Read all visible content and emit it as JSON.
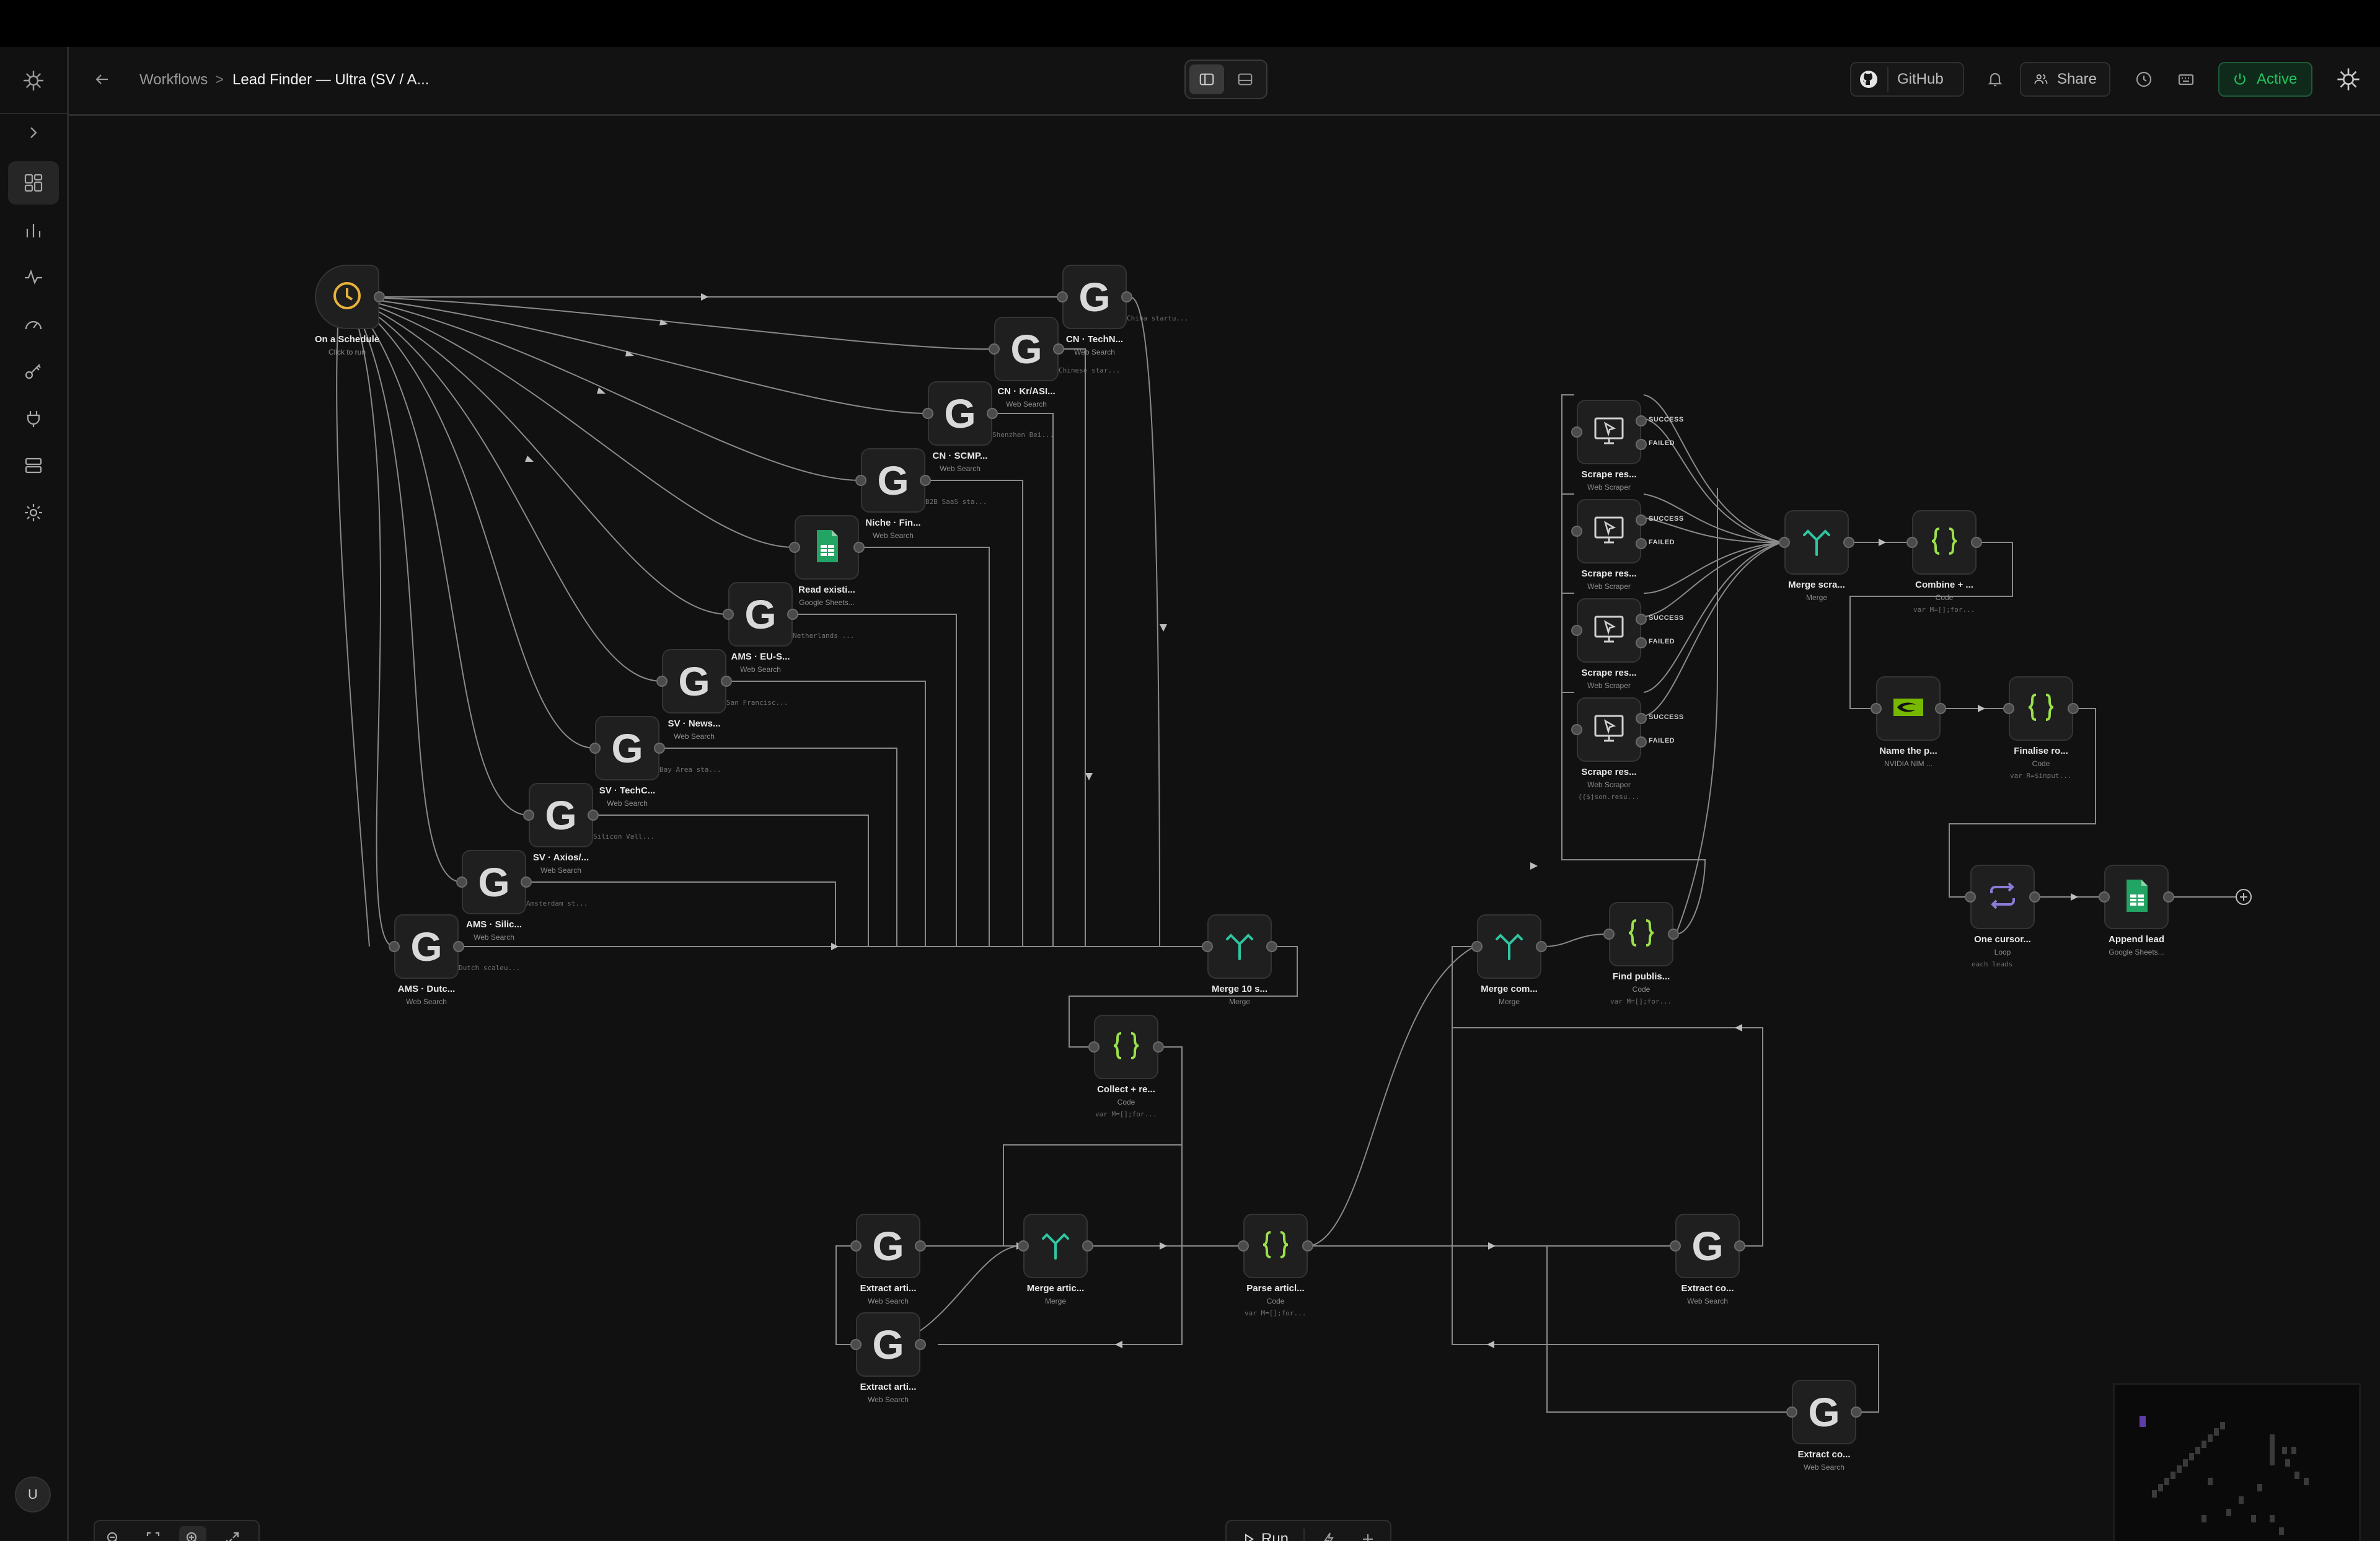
{
  "header": {
    "breadcrumb_root": "Workflows",
    "breadcrumb_sep": ">",
    "workflow_title": "Lead Finder — Ultra (SV / A...",
    "github_label": "GitHub",
    "share_label": "Share",
    "active_label": "Active",
    "active_color": "#22c55e"
  },
  "sidebar": {
    "items": [
      {
        "icon": "workflows-grid-icon"
      },
      {
        "icon": "bar-chart-icon"
      },
      {
        "icon": "activity-icon"
      },
      {
        "icon": "gauge-icon"
      },
      {
        "icon": "key-icon"
      },
      {
        "icon": "plug-icon"
      },
      {
        "icon": "server-icon"
      },
      {
        "icon": "settings-icon"
      }
    ],
    "user_initial": "U"
  },
  "bottom": {
    "run_label": "Run"
  },
  "nodes": [
    {
      "id": "schedule",
      "label": "On a Schedule",
      "sub": "Click to run",
      "icon": "clock-icon"
    },
    {
      "id": "cn-technode",
      "label": "CN · TechN...",
      "sub": "Web Search",
      "code": "China startu...",
      "icon": "google-g-icon"
    },
    {
      "id": "cn-kr",
      "label": "CN · Kr/ASI...",
      "sub": "Web Search",
      "code": "Chinese star...",
      "icon": "google-g-icon"
    },
    {
      "id": "cn-scmp",
      "label": "CN · SCMP...",
      "sub": "Web Search",
      "code": "Shenzhen Bei...",
      "icon": "google-g-icon"
    },
    {
      "id": "niche-fin",
      "label": "Niche · Fin...",
      "sub": "Web Search",
      "code": "B2B SaaS sta...",
      "icon": "google-g-icon"
    },
    {
      "id": "read-existing",
      "label": "Read existi...",
      "sub": "Google Sheets...",
      "icon": "google-sheets-icon"
    },
    {
      "id": "ams-eu",
      "label": "AMS · EU-S...",
      "sub": "Web Search",
      "code": "Netherlands ...",
      "icon": "google-g-icon"
    },
    {
      "id": "sv-news",
      "label": "SV · News...",
      "sub": "Web Search",
      "code": "San Francisc...",
      "icon": "google-g-icon"
    },
    {
      "id": "sv-techc",
      "label": "SV · TechC...",
      "sub": "Web Search",
      "code": "Bay Area sta...",
      "icon": "google-g-icon"
    },
    {
      "id": "sv-axios",
      "label": "SV · Axios/...",
      "sub": "Web Search",
      "code": "Silicon Vall...",
      "icon": "google-g-icon"
    },
    {
      "id": "ams-silic",
      "label": "AMS · Silic...",
      "sub": "Web Search",
      "code": "Amsterdam st...",
      "icon": "google-g-icon"
    },
    {
      "id": "ams-dutch",
      "label": "AMS · Dutc...",
      "sub": "Web Search",
      "code": "Dutch scaleu...",
      "icon": "google-g-icon"
    },
    {
      "id": "merge10",
      "label": "Merge 10 s...",
      "sub": "Merge",
      "icon": "merge-icon"
    },
    {
      "id": "collect",
      "label": "Collect + re...",
      "sub": "Code",
      "code": "var M=[];for...",
      "icon": "code-braces-icon"
    },
    {
      "id": "extract-art1",
      "label": "Extract arti...",
      "sub": "Web Search",
      "icon": "google-g-icon"
    },
    {
      "id": "extract-art2",
      "label": "Extract arti...",
      "sub": "Web Search",
      "icon": "google-g-icon"
    },
    {
      "id": "merge-artic",
      "label": "Merge artic...",
      "sub": "Merge",
      "icon": "merge-icon"
    },
    {
      "id": "parse-artic",
      "label": "Parse articl...",
      "sub": "Code",
      "code": "var M=[];for...",
      "icon": "code-braces-icon"
    },
    {
      "id": "extract-co1",
      "label": "Extract co...",
      "sub": "Web Search",
      "icon": "google-g-icon"
    },
    {
      "id": "extract-co2",
      "label": "Extract co...",
      "sub": "Web Search",
      "icon": "google-g-icon"
    },
    {
      "id": "merge-com",
      "label": "Merge com...",
      "sub": "Merge",
      "icon": "merge-icon"
    },
    {
      "id": "find-publis",
      "label": "Find publis...",
      "sub": "Code",
      "code": "var M=[];for...",
      "icon": "code-braces-icon"
    },
    {
      "id": "scrape1",
      "label": "Scrape res...",
      "sub": "Web Scraper",
      "icon": "monitor-cursor-icon"
    },
    {
      "id": "scrape2",
      "label": "Scrape res...",
      "sub": "Web Scraper",
      "icon": "monitor-cursor-icon"
    },
    {
      "id": "scrape3",
      "label": "Scrape res...",
      "sub": "Web Scraper",
      "icon": "monitor-cursor-icon"
    },
    {
      "id": "scrape4",
      "label": "Scrape res...",
      "sub": "Web Scraper",
      "code": "{{$json.resu...",
      "icon": "monitor-cursor-icon"
    },
    {
      "id": "merge-scra",
      "label": "Merge scra...",
      "sub": "Merge",
      "icon": "merge-icon"
    },
    {
      "id": "combine",
      "label": "Combine + ...",
      "sub": "Code",
      "code": "var M=[];for...",
      "icon": "code-braces-icon"
    },
    {
      "id": "name-the",
      "label": "Name the p...",
      "sub": "NVIDIA NIM ...",
      "icon": "nvidia-icon"
    },
    {
      "id": "finalise",
      "label": "Finalise ro...",
      "sub": "Code",
      "code": "var R=$input...",
      "icon": "code-braces-icon"
    },
    {
      "id": "one-cursor",
      "label": "One cursor...",
      "sub": "Loop",
      "code": "each leads",
      "icon": "loop-icon"
    },
    {
      "id": "append-lead",
      "label": "Append lead",
      "sub": "Google Sheets...",
      "icon": "google-sheets-icon"
    }
  ],
  "output_labels": {
    "success": "SUCCESS",
    "failed": "FAILED"
  }
}
